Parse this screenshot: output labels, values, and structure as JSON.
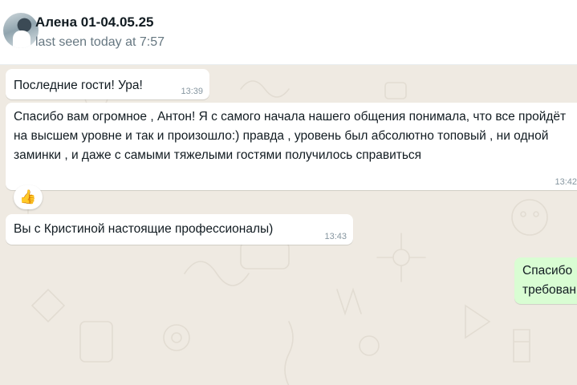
{
  "header": {
    "contact_name": "Алена 01-04.05.25",
    "status": "last seen today at 7:57"
  },
  "messages": [
    {
      "direction": "incoming",
      "text": "Последние гости! Ура!",
      "time": "13:39"
    },
    {
      "direction": "incoming",
      "text": "Спасибо вам огромное , Антон! Я с самого начала нашего общения понимала, что все пройдёт на высшем уровне и так и произошло:) правда , уровень был абсолютно топовый , ни одной заминки , и даже с  самыми тяжелыми гостями получилось справиться",
      "time": "13:42",
      "reaction": "👍"
    },
    {
      "direction": "incoming",
      "text": "Вы с Кристиной настоящие профессионалы)",
      "time": "13:43"
    },
    {
      "direction": "outgoing",
      "text": "Спасибо\nтребован"
    }
  ],
  "colors": {
    "chat_background": "#efeae2",
    "incoming_bubble": "#ffffff",
    "outgoing_bubble": "#d9fdd3",
    "timestamp": "#8696a0"
  }
}
